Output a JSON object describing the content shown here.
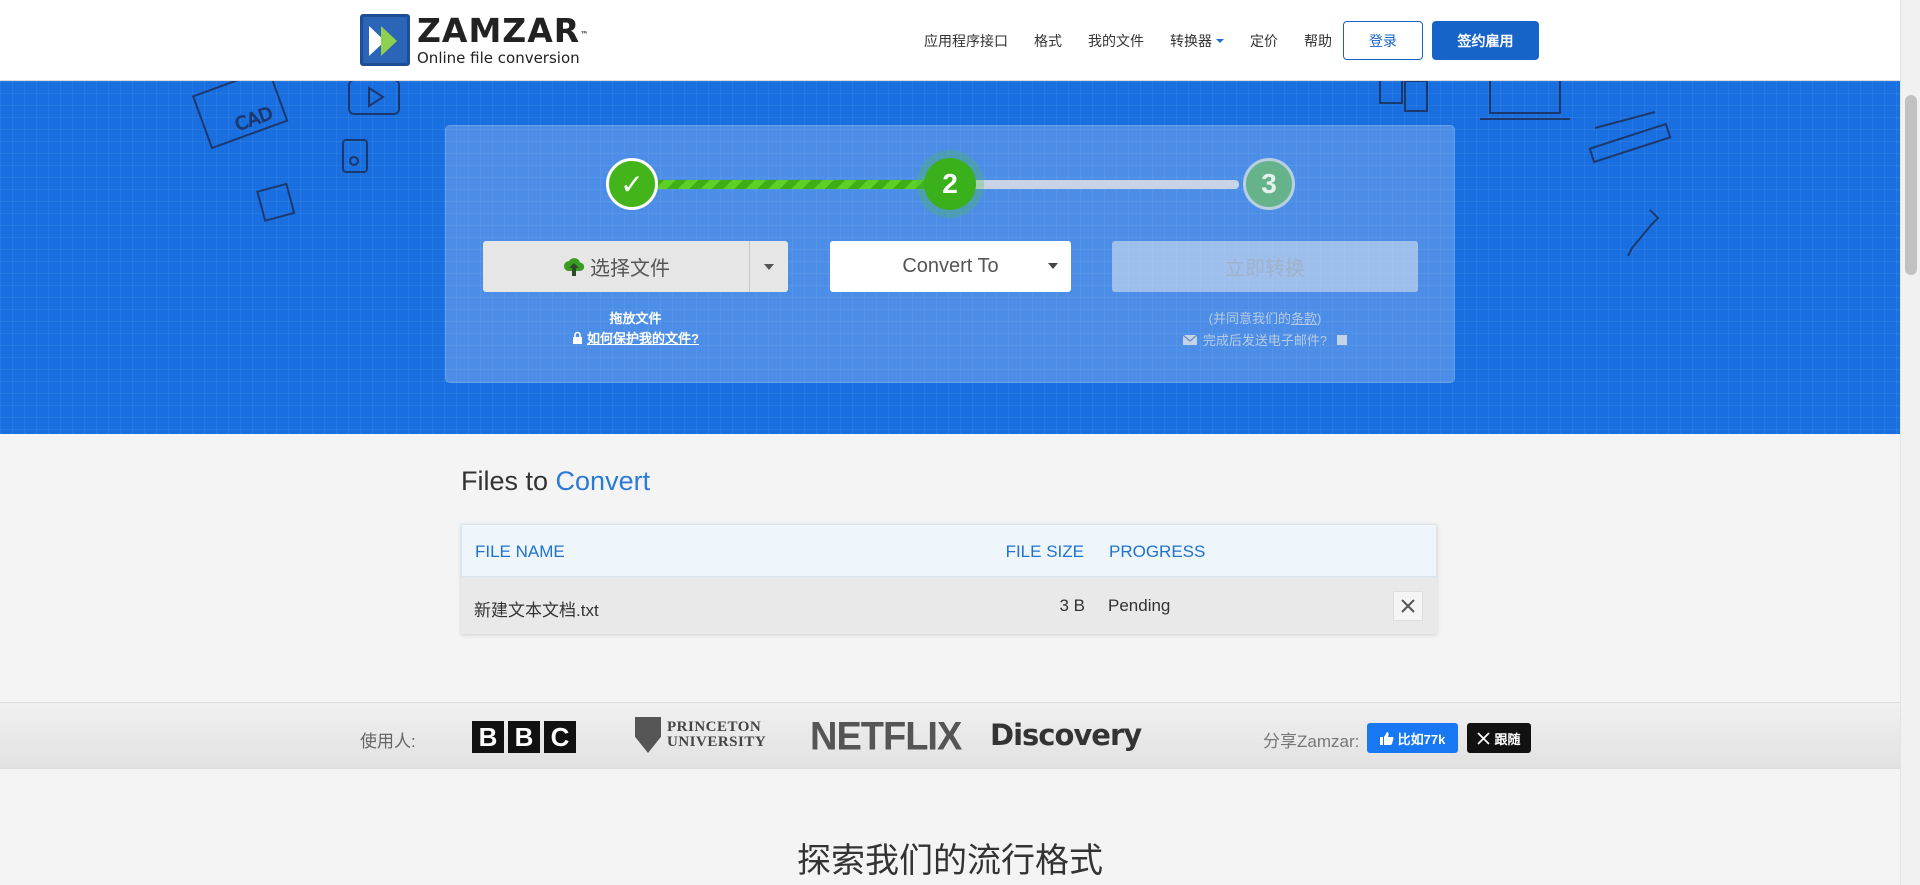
{
  "header": {
    "logo_name": "ZAMZAR",
    "logo_tm": "™",
    "logo_tagline": "Online file conversion",
    "nav": [
      "应用程序接口",
      "格式",
      "我的文件",
      "转换器",
      "定价",
      "帮助"
    ],
    "login_label": "登录",
    "signup_label": "签约雇用"
  },
  "converter": {
    "step1_mark": "✓",
    "step2_label": "2",
    "step3_label": "3",
    "choose_files_label": "选择文件",
    "drop_files_text": "拖放文件",
    "protect_link": "如何保护我的文件?",
    "convert_to_label": "Convert To",
    "convert_now_label": "立即转换",
    "agree_prefix": "(并同意我们的",
    "agree_terms": "条款",
    "agree_suffix": ")",
    "email_label": "完成后发送电子邮件?"
  },
  "files": {
    "title_prefix": "Files to",
    "title_accent": "Convert",
    "columns": {
      "name": "FILE NAME",
      "size": "FILE SIZE",
      "progress": "PROGRESS"
    },
    "rows": [
      {
        "name": "新建文本文档.txt",
        "size": "3 B",
        "progress": "Pending"
      }
    ]
  },
  "used_by": {
    "label": "使用人:",
    "bbc_letters": [
      "B",
      "B",
      "C"
    ],
    "princeton_line1": "PRINCETON",
    "princeton_line2": "UNIVERSITY",
    "netflix": "NETFLIX",
    "discovery": "Discovery"
  },
  "share": {
    "label": "分享Zamzar:",
    "like_label": "比如77k",
    "follow_label": "跟随"
  },
  "explore_title": "探索我们的流行格式",
  "colors": {
    "brand_blue": "#1664c8",
    "hero_blue": "#1a6fe0",
    "step_green": "#43b51a",
    "accent_text": "#2a7ad6"
  }
}
